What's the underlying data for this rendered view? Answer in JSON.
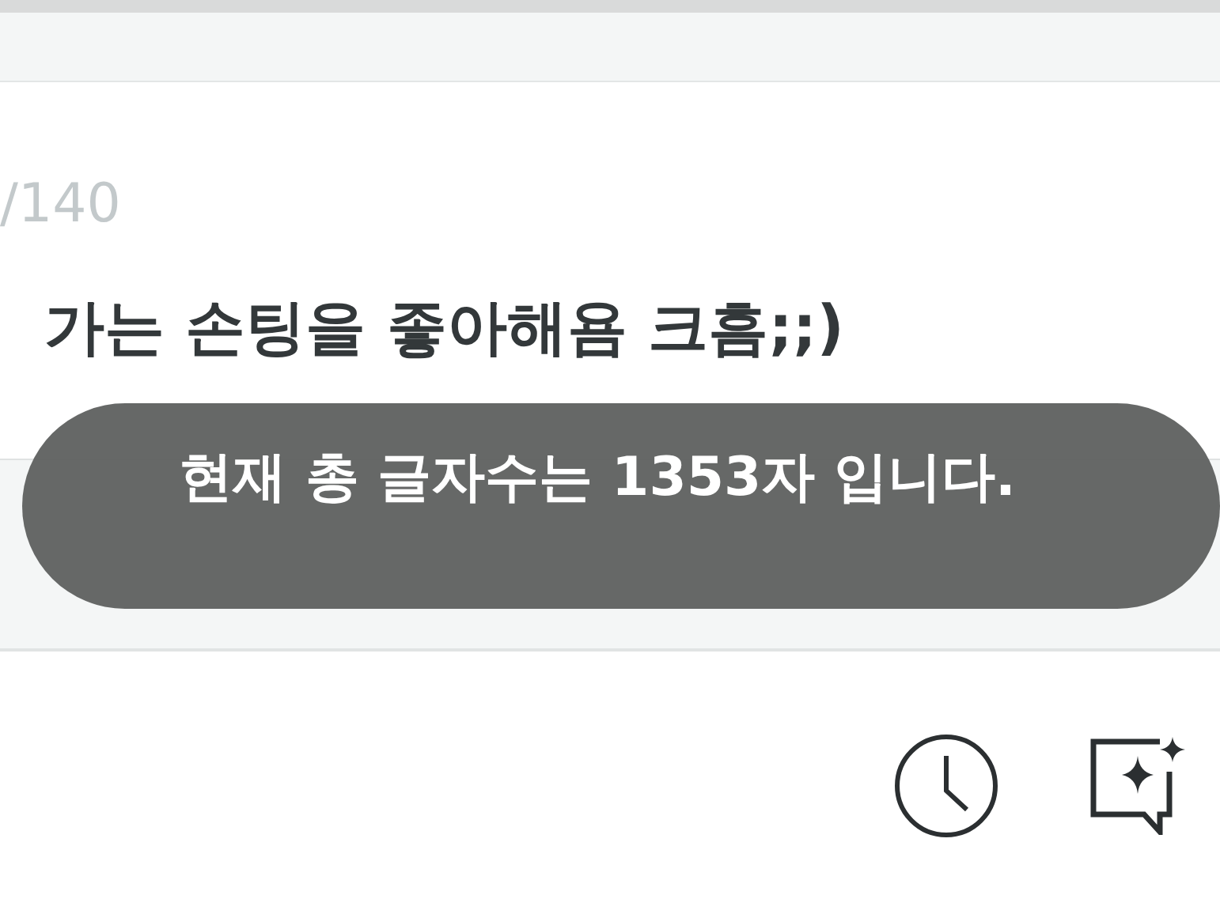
{
  "editor": {
    "counter": "/140",
    "text": "가는 손팅을 좋아해욤 크흠;;)"
  },
  "toast": {
    "message": "현재 총 글자수는 1353자 입니다."
  },
  "toolbar": {
    "buttons": [
      {
        "kind": "history"
      },
      {
        "kind": "ai-comment"
      }
    ]
  }
}
